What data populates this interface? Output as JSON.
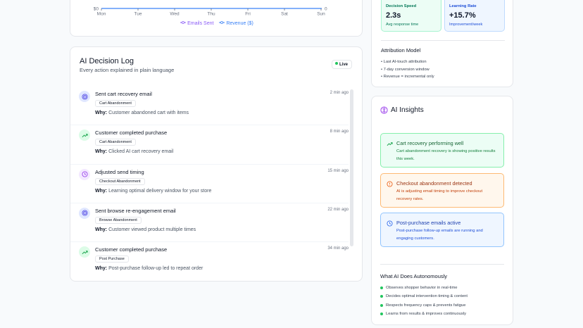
{
  "chart": {
    "y_left_min_label": "$0",
    "y_right_min_label": "0",
    "x_labels": [
      "Mon",
      "Tue",
      "Wed",
      "Thu",
      "Fri",
      "Sat",
      "Sun"
    ],
    "legend": [
      {
        "label": "Emails Sent",
        "color": "#8b5cf6"
      },
      {
        "label": "Revenue ($)",
        "color": "#3b82f6"
      }
    ]
  },
  "log": {
    "title": "AI Decision Log",
    "subtitle": "Every action explained in plain language",
    "live_label": "Live",
    "why_label": "Why:",
    "items": [
      {
        "icon": "target-icon",
        "title": "Sent cart recovery email",
        "time": "2 min ago",
        "badge": "Cart Abandonment",
        "why": "Customer abandoned cart with items"
      },
      {
        "icon": "trending-up-icon",
        "title": "Customer completed purchase",
        "time": "8 min ago",
        "badge": "Cart Abandonment",
        "why": "Clicked AI cart recovery email"
      },
      {
        "icon": "clock-icon",
        "title": "Adjusted send timing",
        "time": "15 min ago",
        "badge": "Checkout Abandonment",
        "why": "Learning optimal delivery window for your store"
      },
      {
        "icon": "target-icon",
        "title": "Sent browse re-engagement email",
        "time": "22 min ago",
        "badge": "Browse Abandonment",
        "why": "Customer viewed product multiple times"
      },
      {
        "icon": "trending-up-icon",
        "title": "Customer completed purchase",
        "time": "34 min ago",
        "badge": "Post Purchase",
        "why": "Post-purchase follow-up led to repeat order"
      }
    ]
  },
  "metrics": [
    {
      "label": "Decision Speed",
      "value": "2.3s",
      "sub": "Avg response time"
    },
    {
      "label": "Learning Rate",
      "value": "+15.7%",
      "sub": "Improvement/week"
    }
  ],
  "attribution": {
    "title": "Attribution Model",
    "items": [
      "• Last AI-touch attribution",
      "• 7-day conversion window",
      "• Revenue = incremental only"
    ]
  },
  "insights": {
    "title": "AI Insights",
    "items": [
      {
        "title": "Cart recovery performing well",
        "desc": "Cart abandonment recovery is showing positive results this week."
      },
      {
        "title": "Checkout abandonment detected",
        "desc": "AI is adjusting email timing to improve checkout recovery rates."
      },
      {
        "title": "Post-purchase emails active",
        "desc": "Post-purchase follow-up emails are running and engaging customers."
      }
    ]
  },
  "autonomous": {
    "title": "What AI Does Autonomously",
    "items": [
      "Observes shopper behavior in real-time",
      "Decides optimal intervention timing & content",
      "Respects frequency caps & prevents fatigue",
      "Learns from results & improves continuously"
    ]
  },
  "colors": {
    "green": "#22c55e",
    "purple": "#8b5cf6",
    "blue": "#3b82f6",
    "orange": "#f97316"
  }
}
